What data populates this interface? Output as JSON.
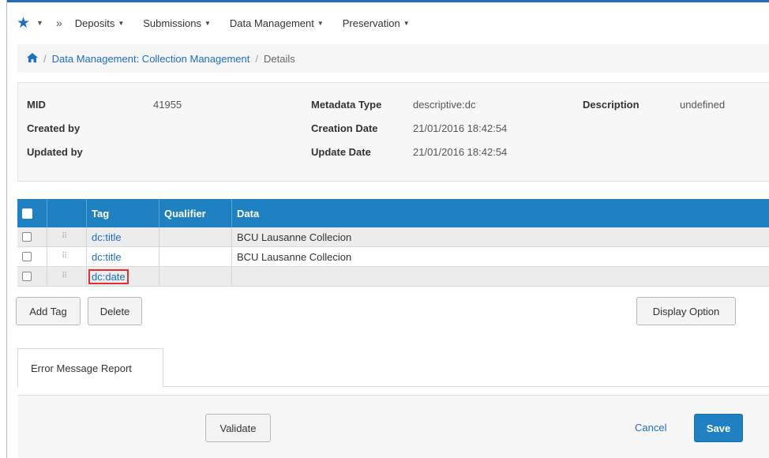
{
  "nav": {
    "menus": [
      {
        "label": "Deposits"
      },
      {
        "label": "Submissions"
      },
      {
        "label": "Data Management"
      },
      {
        "label": "Preservation"
      }
    ]
  },
  "breadcrumb": {
    "link": "Data Management: Collection Management",
    "current": "Details"
  },
  "info": {
    "mid_label": "MID",
    "mid_value": "41955",
    "created_by_label": "Created by",
    "updated_by_label": "Updated by",
    "metadata_type_label": "Metadata Type",
    "metadata_type_value": "descriptive:dc",
    "creation_date_label": "Creation Date",
    "creation_date_value": "21/01/2016 18:42:54",
    "update_date_label": "Update Date",
    "update_date_value": "21/01/2016 18:42:54",
    "description_label": "Description",
    "description_value": "undefined"
  },
  "table": {
    "columns": [
      "Tag",
      "Qualifier",
      "Data"
    ],
    "rows": [
      {
        "tag": "dc:title",
        "qualifier": "",
        "data": "BCU Lausanne Collecion"
      },
      {
        "tag": "dc:title",
        "qualifier": "",
        "data": "BCU Lausanne Collecion"
      },
      {
        "tag": "dc:date",
        "qualifier": "",
        "data": ""
      }
    ]
  },
  "buttons": {
    "add_tag": "Add Tag",
    "delete": "Delete",
    "display_option": "Display Option",
    "validate": "Validate",
    "cancel": "Cancel",
    "save": "Save"
  },
  "tabs": {
    "error_report": "Error Message Report"
  }
}
